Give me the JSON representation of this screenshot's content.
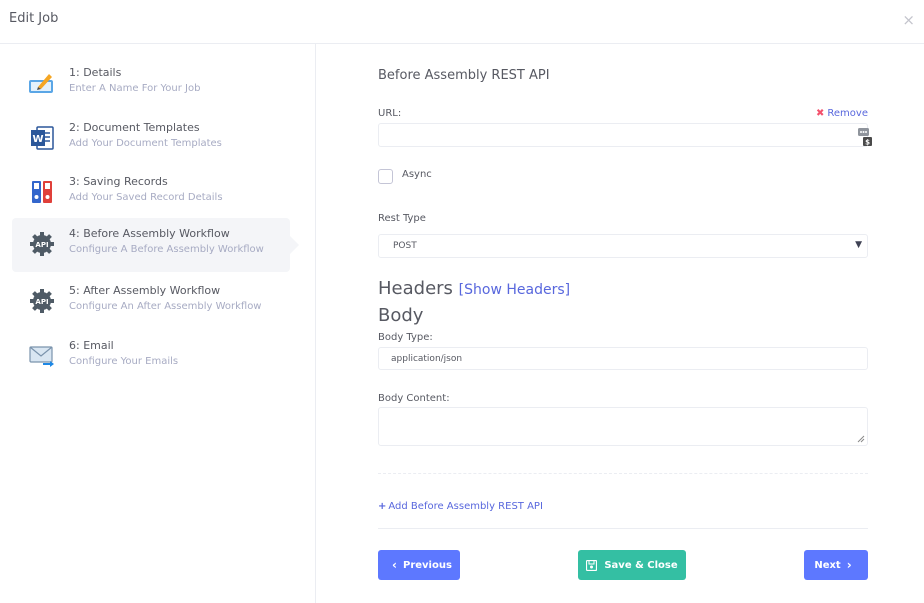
{
  "modal": {
    "title": "Edit Job",
    "close_icon": "×"
  },
  "steps": [
    {
      "title": "1: Details",
      "description": "Enter A Name For Your Job",
      "icon": "edit-icon"
    },
    {
      "title": "2: Document Templates",
      "description": "Add Your Document Templates",
      "icon": "word-icon"
    },
    {
      "title": "3: Saving Records",
      "description": "Add Your Saved Record Details",
      "icon": "binders-icon"
    },
    {
      "title": "4: Before Assembly Workflow",
      "description": "Configure A Before Assembly Workflow",
      "icon": "api-gear-icon",
      "active": true
    },
    {
      "title": "5: After Assembly Workflow",
      "description": "Configure An After Assembly Workflow",
      "icon": "api-gear-icon"
    },
    {
      "title": "6: Email",
      "description": "Configure Your Emails",
      "icon": "email-icon"
    }
  ],
  "form": {
    "section_title": "Before Assembly REST API",
    "url_label": "URL:",
    "url_value": "",
    "remove_label": "Remove",
    "async_label": "Async",
    "async_checked": false,
    "rest_type_label": "Rest Type",
    "rest_type_value": "POST",
    "headers_title": "Headers",
    "show_headers_label": "[Show Headers]",
    "body_title": "Body",
    "body_type_label": "Body Type:",
    "body_type_value": "application/json",
    "body_content_label": "Body Content:",
    "body_content_value": "",
    "add_label": "Add Before Assembly REST API"
  },
  "buttons": {
    "previous": "Previous",
    "save_close": "Save & Close",
    "next": "Next"
  },
  "colors": {
    "primary": "#5d78ff",
    "success": "#34bfa3",
    "link": "#5867dd",
    "danger": "#f4516c",
    "active_step_bg": "#f4f5f8"
  }
}
